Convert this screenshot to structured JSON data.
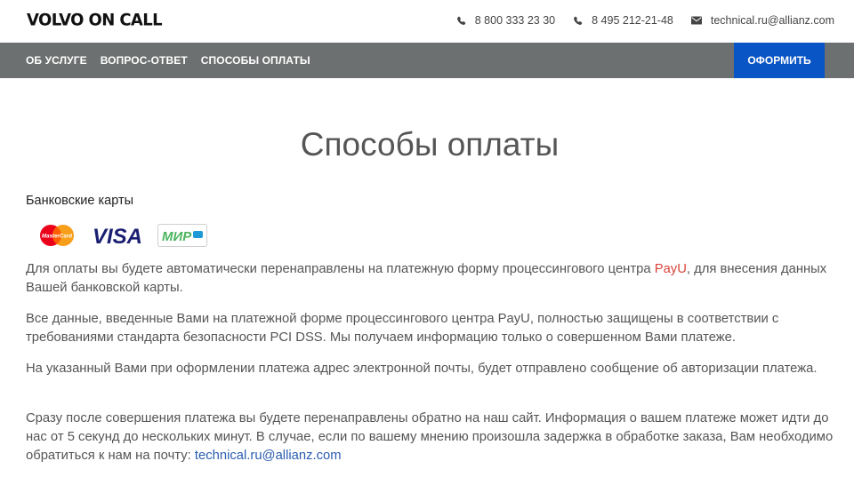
{
  "header": {
    "logo": "VOLVO ON CALL",
    "phone1": "8 800 333 23 30",
    "phone2": "8 495 212-21-48",
    "email": "technical.ru@allianz.com",
    "icons": [
      "phone-icon",
      "phone-icon",
      "envelope-icon"
    ]
  },
  "nav": {
    "items": [
      "ОБ УСЛУГЕ",
      "ВОПРОС-ОТВЕТ",
      "СПОСОБЫ ОПЛАТЫ"
    ],
    "order_button": "ОФОРМИТЬ"
  },
  "main": {
    "title": "Способы оплаты",
    "bank_cards_label": "Банковские карты",
    "card_logos": {
      "mastercard": "MasterCard",
      "visa": "VISA",
      "mir": "МИР"
    },
    "p1_before": "Для оплаты вы будете автоматически перенаправлены на платежную форму процессингового центра ",
    "p1_link": "PayU",
    "p1_after": ", для внесения данных Вашей банковской карты.",
    "p2": "Все данные, введенные Вами на платежной форме процессингового центра PayU, полностью защищены в соответствии с требованиями стандарта безопасности PCI DSS. Мы получаем информацию только о совершенном Вами платеже.",
    "p3": "На указанный Вами при оформлении платежа адрес электронной почты, будет отправлено сообщение об авторизации платежа.",
    "p4_before": "Сразу после совершения платежа вы будете перенаправлены обратно на наш сайт. Информация о вашем платеже может идти до нас от 5 секунд до нескольких минут. В случае, если по вашему мнению произошла задержка в обработке заказа, Вам необходимо обратиться к нам на почту: ",
    "p4_link": "technical.ru@allianz.com"
  },
  "colors": {
    "nav_bg": "#6d7070",
    "order_button_bg": "#0a55c5",
    "link_red": "#d9463b",
    "link_blue": "#2a5db0",
    "mastercard_red": "#eb001b",
    "mastercard_orange": "#f79e1b",
    "visa_blue": "#1a1f71",
    "mir_green": "#4db45e"
  }
}
